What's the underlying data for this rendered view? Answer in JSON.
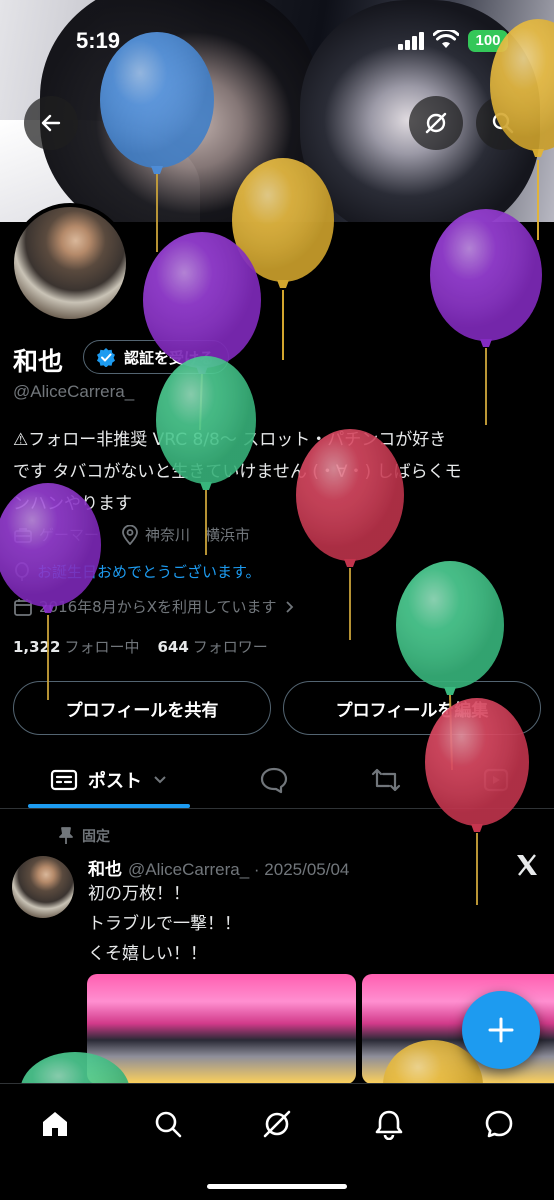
{
  "status_bar": {
    "time": "5:19",
    "battery": "100"
  },
  "profile": {
    "name": "和也",
    "verify_label": "認証を受ける",
    "handle": "@AliceCarrera_",
    "bio_lines": [
      "⚠フォロー非推奨 VRC 8/8～ スロット・パチンコが好き",
      "です タバコがないと生きていけません (・∀・) しばらくモ",
      "ンハンやります"
    ],
    "category": "ゲーマー",
    "location": "神奈川　横浜市",
    "birthday": "お誕生日おめでとうございます。",
    "joined": "2016年8月からXを利用しています",
    "following_count": "1,322",
    "following_label": "フォロー中",
    "followers_count": "644",
    "followers_label": "フォロワー"
  },
  "buttons": {
    "share": "プロフィールを共有",
    "edit": "プロフィールを編集"
  },
  "tabs": {
    "posts": "ポスト"
  },
  "post": {
    "pinned_label": "固定",
    "author": "和也",
    "handle": "@AliceCarrera_",
    "date": "2025/05/04",
    "lines": [
      "初の万枚！！",
      "トラブルで一撃！！",
      "くそ嬉しい！！"
    ]
  },
  "colors": {
    "accent": "#1d9bf0",
    "balloon_blue": "#4a90e2",
    "balloon_yellow": "#e5b532",
    "balloon_purple": "#8e2fd0",
    "balloon_green": "#3fc98a",
    "balloon_red": "#d63a55"
  },
  "icons": [
    "back-arrow-icon",
    "grok-icon",
    "search-icon",
    "verified-badge-icon",
    "briefcase-icon",
    "location-pin-icon",
    "balloon-icon",
    "calendar-icon",
    "chevron-right-icon",
    "posts-tab-icon",
    "chevron-down-icon",
    "reply-tab-icon",
    "repost-tab-icon",
    "video-tab-icon",
    "pin-icon",
    "x-logo-icon",
    "plus-icon",
    "home-icon",
    "explore-icon",
    "grok-nav-icon",
    "notifications-icon",
    "messages-icon"
  ]
}
